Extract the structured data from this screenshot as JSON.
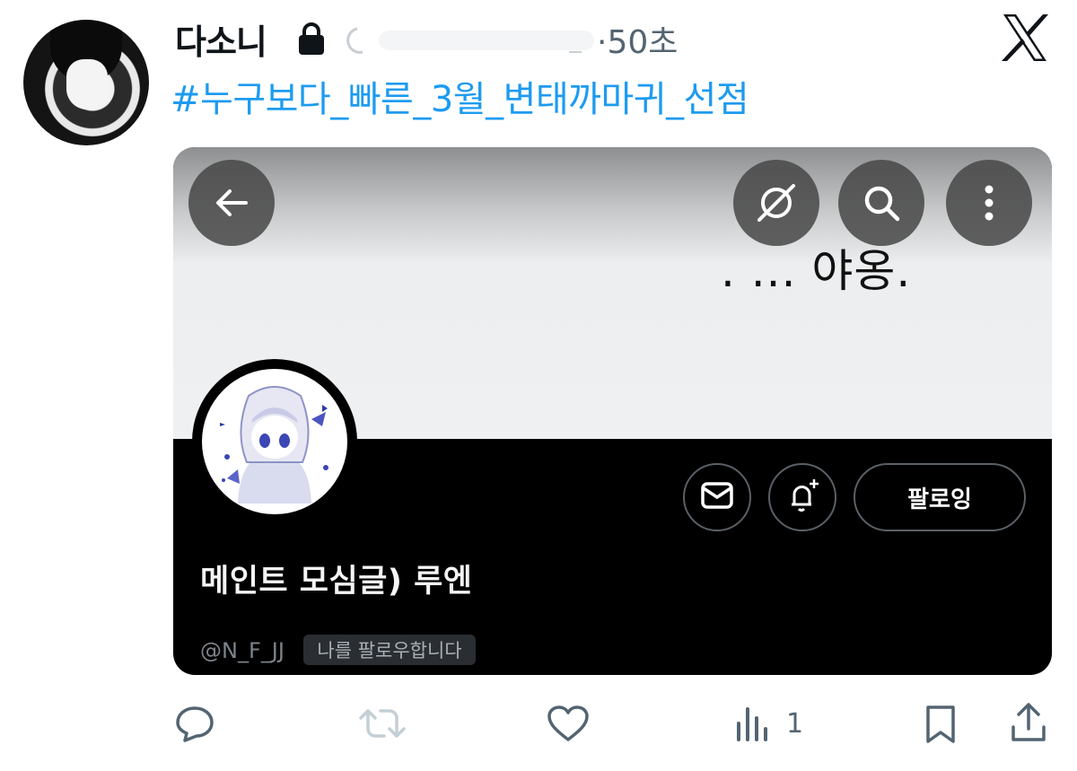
{
  "tweet": {
    "author_name": "다소니",
    "time": "·50초",
    "text": "#누구보다_빠른_3월_변태까마귀_선점"
  },
  "embedded_profile": {
    "banner_text": ". ... 야옹.",
    "display_name": "메인트 모심글) 루엔",
    "handle": "@N_F_JJ",
    "follows_you": "나를 팔로우합니다",
    "follow_button_label": "팔로잉",
    "icons": [
      "back-arrow-icon",
      "grok-icon",
      "search-icon",
      "more-icon",
      "mail-icon",
      "bell-plus-icon"
    ]
  },
  "actions": {
    "views": "1",
    "icons": [
      "reply-icon",
      "retweet-icon",
      "like-icon",
      "views-icon",
      "bookmark-icon",
      "share-icon"
    ]
  },
  "colors": {
    "link": "#1d9bf0",
    "muted": "#536471",
    "card_dark": "#000000"
  }
}
